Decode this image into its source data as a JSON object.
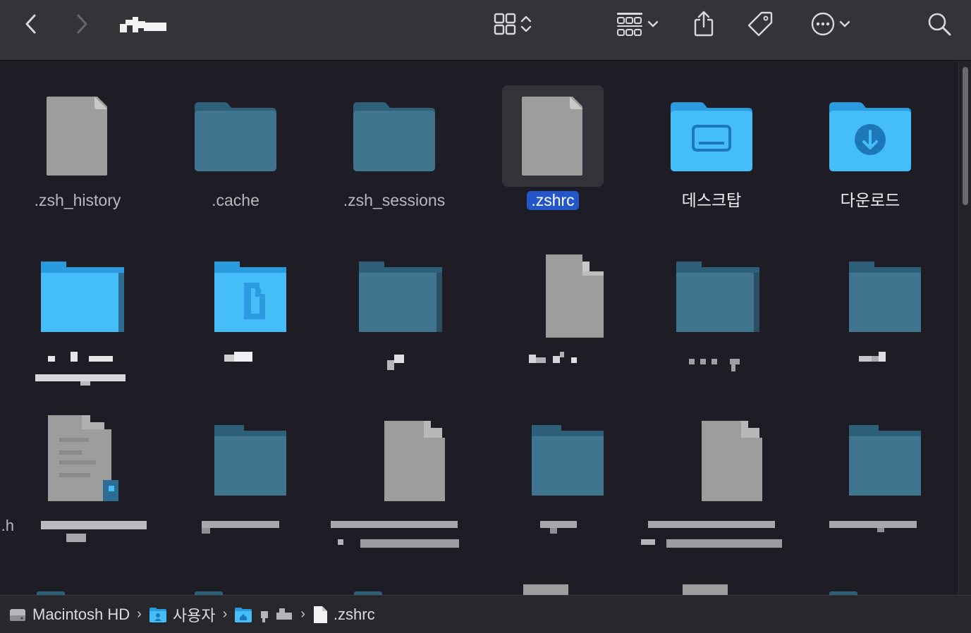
{
  "toolbar": {
    "back_label": "Back",
    "forward_label": "Forward",
    "title_blurred": true,
    "icons": [
      "chevron-left-icon",
      "chevron-right-icon",
      "grid-view-icon",
      "updown-chevron-icon",
      "group-icon",
      "chevron-down-icon",
      "share-icon",
      "tag-icon",
      "more-icon",
      "chevron-down-icon",
      "search-icon"
    ]
  },
  "items": [
    {
      "name": ".zsh_history",
      "kind": "document"
    },
    {
      "name": ".cache",
      "kind": "folder-dim"
    },
    {
      "name": ".zsh_sessions",
      "kind": "folder-dim"
    },
    {
      "name": ".zshrc",
      "kind": "document",
      "selected": true
    },
    {
      "name": "데스크탑",
      "kind": "folder-desktop"
    },
    {
      "name": "다운로드",
      "kind": "folder-downloads"
    },
    {
      "name": "",
      "kind": "folder-bright",
      "blurred": true
    },
    {
      "name": "",
      "kind": "folder-documents",
      "blurred": true
    },
    {
      "name": "",
      "kind": "folder-dim",
      "blurred": true
    },
    {
      "name": "",
      "kind": "document",
      "blurred": true
    },
    {
      "name": "",
      "kind": "folder-dim",
      "blurred": true
    },
    {
      "name": "",
      "kind": "folder-dim",
      "blurred": true
    },
    {
      "name": ".h",
      "kind": "text-document",
      "blurred": true
    },
    {
      "name": "",
      "kind": "folder-dim",
      "blurred": true
    },
    {
      "name": "",
      "kind": "document",
      "blurred": true
    },
    {
      "name": "",
      "kind": "folder-dim",
      "blurred": true
    },
    {
      "name": "",
      "kind": "document",
      "blurred": true
    },
    {
      "name": "",
      "kind": "folder-dim",
      "blurred": true
    }
  ],
  "pathbar": {
    "segments": [
      "Macintosh HD",
      "사용자",
      "",
      ".zshrc"
    ]
  },
  "colors": {
    "selection": "#2357c8",
    "folder_bright": "#3fb8f5",
    "folder_dim": "#3f7590",
    "document": "#9d9d9d"
  }
}
